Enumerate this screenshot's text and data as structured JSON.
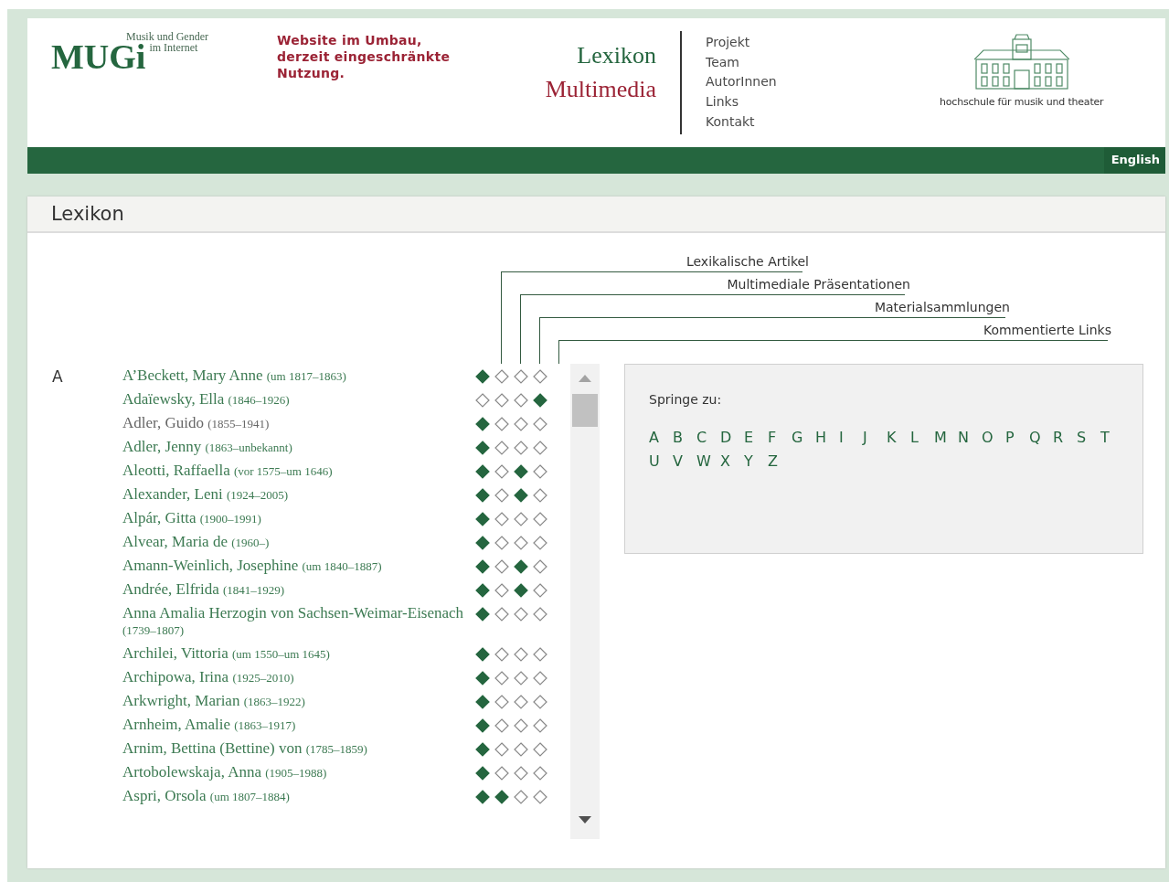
{
  "header": {
    "logo": {
      "word": "MUGi",
      "line_1": "Musik und Gender",
      "line_2": "im Internet"
    },
    "notice": "Website im Umbau, derzeit eingeschränkte Nutzung.",
    "sections": [
      {
        "label": "Lexikon",
        "kind": "primary"
      },
      {
        "label": "Multimedia",
        "kind": "secondary"
      }
    ],
    "nav": [
      "Projekt",
      "Team",
      "AutorInnen",
      "Links",
      "Kontakt"
    ],
    "partner": "hochschule für musik und theater"
  },
  "language_link": "English",
  "panel": {
    "title": "Lexikon",
    "legend": [
      "Lexikalische Artikel",
      "Multimediale Präsentationen",
      "Materialsammlungen",
      "Kommentierte Links"
    ],
    "letter": "A",
    "entries": [
      {
        "name": "A’Beckett, Mary Anne",
        "dates": "(um 1817–1863)",
        "visited": false,
        "marks": [
          true,
          false,
          false,
          false
        ]
      },
      {
        "name": "Adaïewsky, Ella",
        "dates": "(1846–1926)",
        "visited": false,
        "marks": [
          false,
          false,
          false,
          true
        ]
      },
      {
        "name": "Adler, Guido",
        "dates": "(1855–1941)",
        "visited": true,
        "marks": [
          true,
          false,
          false,
          false
        ]
      },
      {
        "name": "Adler, Jenny",
        "dates": "(1863–unbekannt)",
        "visited": false,
        "marks": [
          true,
          false,
          false,
          false
        ]
      },
      {
        "name": "Aleotti, Raffaella",
        "dates": "(vor 1575–um 1646)",
        "visited": false,
        "marks": [
          true,
          false,
          true,
          false
        ]
      },
      {
        "name": "Alexander, Leni",
        "dates": "(1924–2005)",
        "visited": false,
        "marks": [
          true,
          false,
          true,
          false
        ]
      },
      {
        "name": "Alpár, Gitta",
        "dates": "(1900–1991)",
        "visited": false,
        "marks": [
          true,
          false,
          false,
          false
        ]
      },
      {
        "name": "Alvear, Maria de",
        "dates": "(1960–)",
        "visited": false,
        "marks": [
          true,
          false,
          false,
          false
        ]
      },
      {
        "name": "Amann-Weinlich, Josephine",
        "dates": "(um 1840–1887)",
        "visited": false,
        "marks": [
          true,
          false,
          true,
          false
        ]
      },
      {
        "name": "Andrée, Elfrida",
        "dates": "(1841–1929)",
        "visited": false,
        "marks": [
          true,
          false,
          true,
          false
        ]
      },
      {
        "name": "Anna Amalia Herzogin von Sachsen-Weimar-Eisenach",
        "dates": "(1739–1807)",
        "visited": false,
        "marks": [
          true,
          false,
          false,
          false
        ]
      },
      {
        "name": "Archilei, Vittoria",
        "dates": "(um 1550–um 1645)",
        "visited": false,
        "marks": [
          true,
          false,
          false,
          false
        ]
      },
      {
        "name": "Archipowa, Irina",
        "dates": "(1925–2010)",
        "visited": false,
        "marks": [
          true,
          false,
          false,
          false
        ]
      },
      {
        "name": "Arkwright, Marian",
        "dates": "(1863–1922)",
        "visited": false,
        "marks": [
          true,
          false,
          false,
          false
        ]
      },
      {
        "name": "Arnheim, Amalie",
        "dates": "(1863–1917)",
        "visited": false,
        "marks": [
          true,
          false,
          false,
          false
        ]
      },
      {
        "name": "Arnim, Bettina (Bettine) von",
        "dates": "(1785–1859)",
        "visited": false,
        "marks": [
          true,
          false,
          false,
          false
        ]
      },
      {
        "name": "Artobolewskaja, Anna",
        "dates": "(1905–1988)",
        "visited": false,
        "marks": [
          true,
          false,
          false,
          false
        ]
      },
      {
        "name": "Aspri, Orsola",
        "dates": "(um 1807–1884)",
        "visited": false,
        "marks": [
          true,
          true,
          false,
          false
        ]
      }
    ],
    "jump": {
      "label": "Springe zu:",
      "letters": [
        "A",
        "B",
        "C",
        "D",
        "E",
        "F",
        "G",
        "H",
        "I",
        "J",
        "K",
        "L",
        "M",
        "N",
        "O",
        "P",
        "Q",
        "R",
        "S",
        "T",
        "U",
        "V",
        "W",
        "X",
        "Y",
        "Z"
      ]
    }
  }
}
